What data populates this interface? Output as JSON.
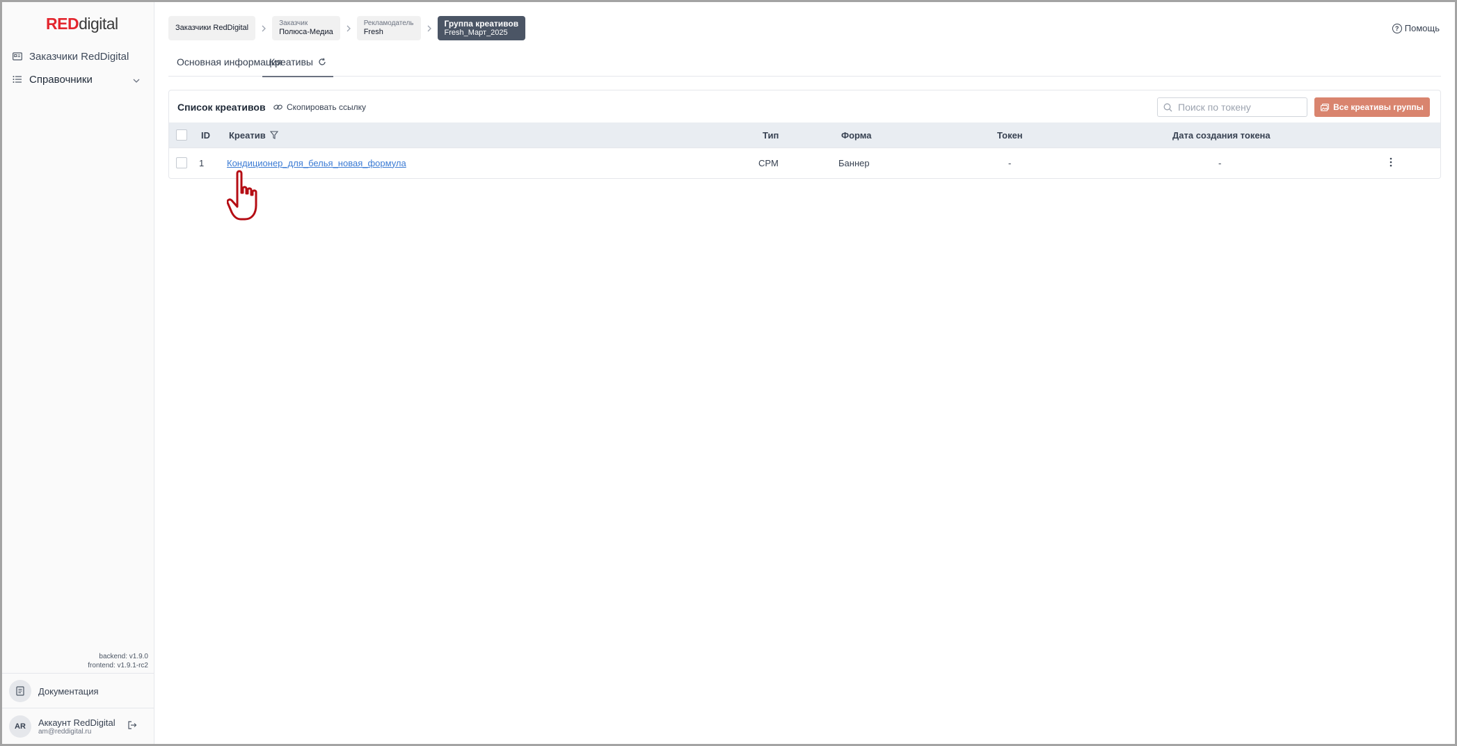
{
  "sidebar": {
    "logo_red": "RED",
    "logo_rest": "digital",
    "items": [
      {
        "label": "Заказчики RedDigital",
        "icon": "id-card-icon"
      },
      {
        "label": "Справочники",
        "icon": "list-icon"
      }
    ],
    "backend_version": "backend: v1.9.0",
    "frontend_version": "frontend: v1.9.1-rc2",
    "docs_label": "Документация",
    "account": {
      "initials": "AR",
      "name": "Аккаунт RedDigital",
      "email": "am@reddigital.ru"
    }
  },
  "breadcrumbs": [
    {
      "small": "",
      "label": "Заказчики RedDigital"
    },
    {
      "small": "Заказчик",
      "label": "Полюса-Медиа"
    },
    {
      "small": "Рекламодатель",
      "label": "Fresh"
    },
    {
      "small": "Группа креативов",
      "label": "Fresh_Март_2025"
    }
  ],
  "help_label": "Помощь",
  "tabs": [
    {
      "label": "Основная информация"
    },
    {
      "label": "Креативы"
    }
  ],
  "panel": {
    "title": "Список креативов",
    "copy_link": "Скопировать ссылку",
    "search_placeholder": "Поиск по токену",
    "all_button": "Все креативы группы"
  },
  "table": {
    "columns": {
      "id": "ID",
      "creative": "Креатив",
      "type": "Тип",
      "form": "Форма",
      "token": "Токен",
      "token_date": "Дата создания токена"
    },
    "rows": [
      {
        "id": "1",
        "creative": "Кондиционер_для_белья_новая_формула",
        "type": "CPM",
        "form": "Баннер",
        "token": "-",
        "token_date": "-"
      }
    ]
  },
  "colors": {
    "accent_red": "#e3262e",
    "active_crumb": "#4b5565",
    "primary_button": "#d9846e",
    "link": "#3b7bd4"
  }
}
